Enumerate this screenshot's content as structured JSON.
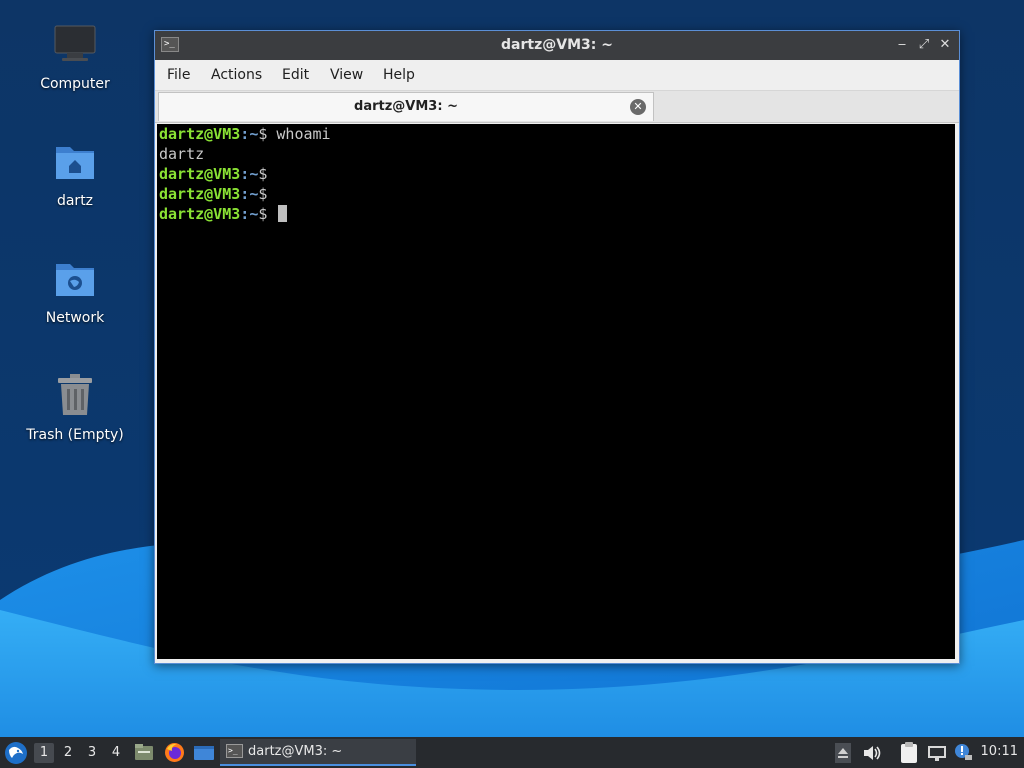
{
  "desktop": {
    "icons": [
      {
        "label": "Computer"
      },
      {
        "label": "dartz"
      },
      {
        "label": "Network"
      },
      {
        "label": "Trash (Empty)"
      }
    ]
  },
  "window": {
    "title": "dartz@VM3: ~",
    "controls": {
      "minimize": "‒",
      "maximize": "⤢",
      "close": "✕"
    },
    "menu": [
      "File",
      "Actions",
      "Edit",
      "View",
      "Help"
    ],
    "tab": {
      "label": "dartz@VM3: ~"
    },
    "terminal": {
      "lines": [
        {
          "user": "dartz@VM3",
          "sep": ":",
          "path": "~",
          "prompt": "$",
          "cmd": " whoami"
        },
        {
          "output": "dartz"
        },
        {
          "user": "dartz@VM3",
          "sep": ":",
          "path": "~",
          "prompt": "$",
          "cmd": ""
        },
        {
          "user": "dartz@VM3",
          "sep": ":",
          "path": "~",
          "prompt": "$",
          "cmd": ""
        },
        {
          "user": "dartz@VM3",
          "sep": ":",
          "path": "~",
          "prompt": "$",
          "cmd": " "
        }
      ]
    }
  },
  "taskbar": {
    "workspaces": [
      "1",
      "2",
      "3",
      "4"
    ],
    "active_workspace": "1",
    "task": {
      "label": "dartz@VM3: ~"
    },
    "clock": "10:11"
  },
  "colors": {
    "prompt_user": "#8ae234",
    "prompt_path": "#729fcf",
    "accent": "#4a8fe0"
  }
}
